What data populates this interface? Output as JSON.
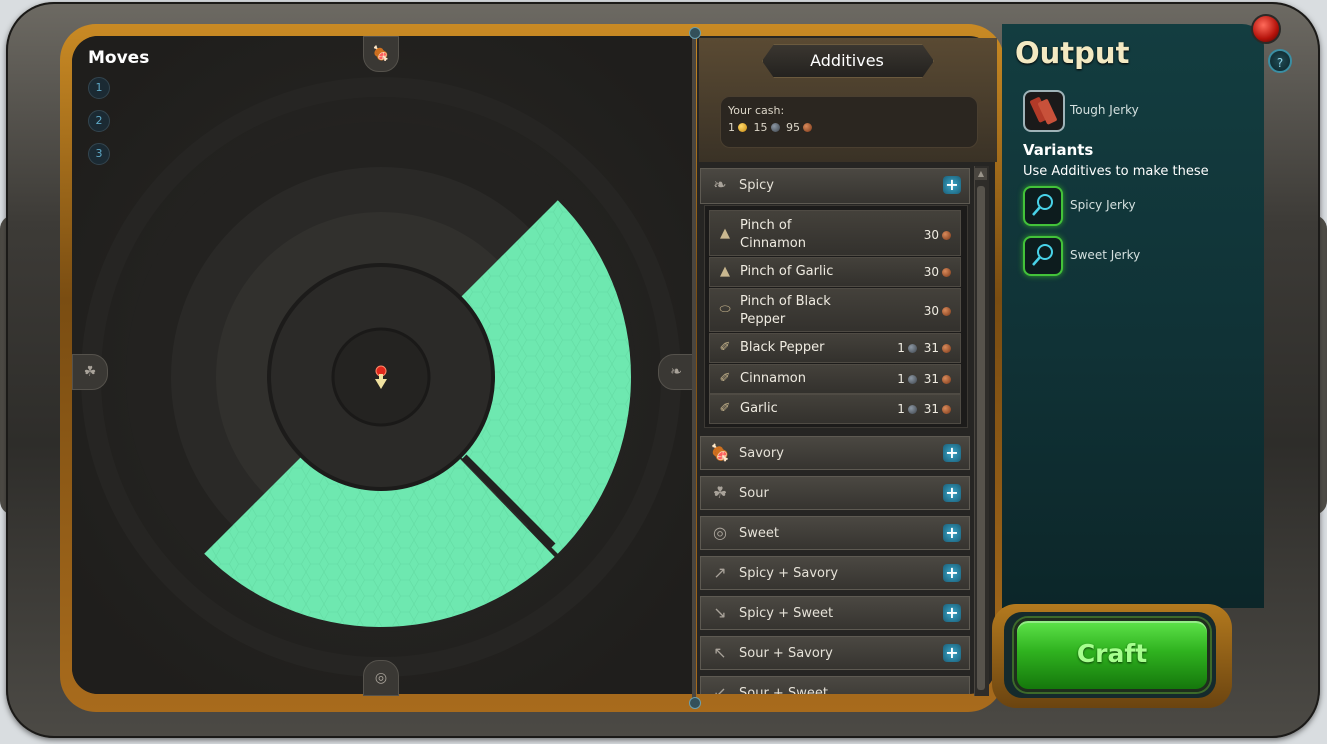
{
  "moves": {
    "title": "Moves",
    "items": [
      "1",
      "2",
      "3"
    ]
  },
  "board": {
    "edge_icons": {
      "top": "meat-icon",
      "bottom": "sweet-icon",
      "left": "sour-icon",
      "right": "pepper-icon"
    },
    "marker_icon": "pin-arrow-icon",
    "highlight_color": "#6ee8b0"
  },
  "additives": {
    "title": "Additives",
    "cash_label": "Your cash:",
    "cash": {
      "gold": "1",
      "silver": "15",
      "copper": "95"
    },
    "categories": [
      {
        "label": "Spicy",
        "icon": "pepper-icon"
      },
      {
        "label": "Savory",
        "icon": "meat-icon"
      },
      {
        "label": "Sour",
        "icon": "sour-icon"
      },
      {
        "label": "Sweet",
        "icon": "sweet-icon"
      },
      {
        "label": "Spicy + Savory",
        "icon": "arrow-up-right-icon"
      },
      {
        "label": "Spicy + Sweet",
        "icon": "arrow-down-right-icon"
      },
      {
        "label": "Sour + Savory",
        "icon": "arrow-up-left-icon"
      },
      {
        "label": "Sour + Sweet",
        "icon": "arrow-down-left-icon"
      }
    ],
    "spicy_items": [
      {
        "label_line1": "Pinch of",
        "label_line2": "Cinnamon",
        "silver": "",
        "copper": "30",
        "icon": "spice-pile-icon"
      },
      {
        "label_line1": "Pinch of Garlic",
        "label_line2": "",
        "silver": "",
        "copper": "30",
        "icon": "spice-pile-icon"
      },
      {
        "label_line1": "Pinch of Black",
        "label_line2": "Pepper",
        "silver": "",
        "copper": "30",
        "icon": "spice-dish-icon"
      },
      {
        "label_line1": "Black Pepper",
        "label_line2": "",
        "silver": "1",
        "copper": "31",
        "icon": "spice-bottle-icon"
      },
      {
        "label_line1": "Cinnamon",
        "label_line2": "",
        "silver": "1",
        "copper": "31",
        "icon": "spice-bottle-icon"
      },
      {
        "label_line1": "Garlic",
        "label_line2": "",
        "silver": "1",
        "copper": "31",
        "icon": "spice-bottle-icon"
      }
    ]
  },
  "output": {
    "title": "Output",
    "product": "Tough Jerky",
    "variants_title": "Variants",
    "variants_sub": "Use Additives to make these",
    "variants": [
      "Spicy Jerky",
      "Sweet Jerky"
    ]
  },
  "craft_label": "Craft",
  "help_label": "?"
}
